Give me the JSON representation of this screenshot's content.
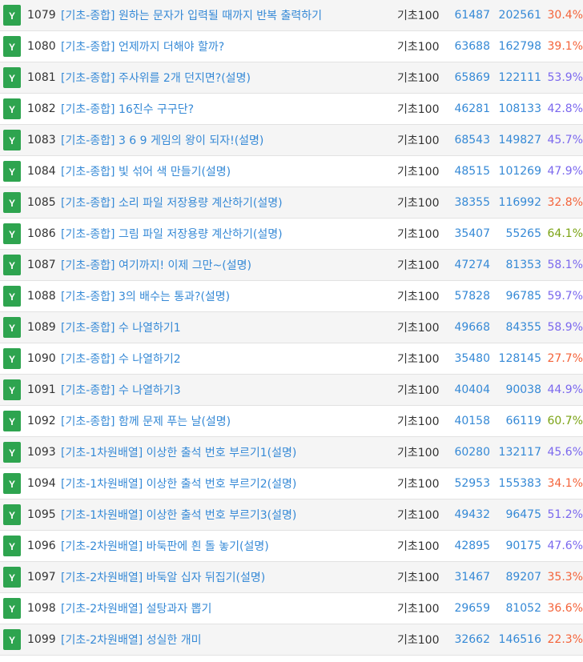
{
  "colors": {
    "badge": "#2ea44f",
    "link": "#3589d6",
    "rate_high": "#7ba314",
    "rate_mid": "#7b68ee",
    "rate_low": "#f4633a"
  },
  "problems": [
    {
      "badge": "Y",
      "id": "1079",
      "title": "[기초-종합] 원하는 문자가 입력될 때까지 반복 출력하기",
      "level": "기초100",
      "solved": "61487",
      "submissions": "202561",
      "rate": "30.4%",
      "rate_color": "#f4633a"
    },
    {
      "badge": "Y",
      "id": "1080",
      "title": "[기초-종합] 언제까지 더해야 할까?",
      "level": "기초100",
      "solved": "63688",
      "submissions": "162798",
      "rate": "39.1%",
      "rate_color": "#f4633a"
    },
    {
      "badge": "Y",
      "id": "1081",
      "title": "[기초-종합] 주사위를 2개 던지면?(설명)",
      "level": "기초100",
      "solved": "65869",
      "submissions": "122111",
      "rate": "53.9%",
      "rate_color": "#7b68ee"
    },
    {
      "badge": "Y",
      "id": "1082",
      "title": "[기초-종합] 16진수 구구단?",
      "level": "기초100",
      "solved": "46281",
      "submissions": "108133",
      "rate": "42.8%",
      "rate_color": "#7b68ee"
    },
    {
      "badge": "Y",
      "id": "1083",
      "title": "[기초-종합] 3 6 9 게임의 왕이 되자!(설명)",
      "level": "기초100",
      "solved": "68543",
      "submissions": "149827",
      "rate": "45.7%",
      "rate_color": "#7b68ee"
    },
    {
      "badge": "Y",
      "id": "1084",
      "title": "[기초-종합] 빛 섞어 색 만들기(설명)",
      "level": "기초100",
      "solved": "48515",
      "submissions": "101269",
      "rate": "47.9%",
      "rate_color": "#7b68ee"
    },
    {
      "badge": "Y",
      "id": "1085",
      "title": "[기초-종합] 소리 파일 저장용량 계산하기(설명)",
      "level": "기초100",
      "solved": "38355",
      "submissions": "116992",
      "rate": "32.8%",
      "rate_color": "#f4633a"
    },
    {
      "badge": "Y",
      "id": "1086",
      "title": "[기초-종합] 그림 파일 저장용량 계산하기(설명)",
      "level": "기초100",
      "solved": "35407",
      "submissions": "55265",
      "rate": "64.1%",
      "rate_color": "#7ba314"
    },
    {
      "badge": "Y",
      "id": "1087",
      "title": "[기초-종합] 여기까지! 이제 그만~(설명)",
      "level": "기초100",
      "solved": "47274",
      "submissions": "81353",
      "rate": "58.1%",
      "rate_color": "#7b68ee"
    },
    {
      "badge": "Y",
      "id": "1088",
      "title": "[기초-종합] 3의 배수는 통과?(설명)",
      "level": "기초100",
      "solved": "57828",
      "submissions": "96785",
      "rate": "59.7%",
      "rate_color": "#7b68ee"
    },
    {
      "badge": "Y",
      "id": "1089",
      "title": "[기초-종합] 수 나열하기1",
      "level": "기초100",
      "solved": "49668",
      "submissions": "84355",
      "rate": "58.9%",
      "rate_color": "#7b68ee"
    },
    {
      "badge": "Y",
      "id": "1090",
      "title": "[기초-종합] 수 나열하기2",
      "level": "기초100",
      "solved": "35480",
      "submissions": "128145",
      "rate": "27.7%",
      "rate_color": "#f4633a"
    },
    {
      "badge": "Y",
      "id": "1091",
      "title": "[기초-종합] 수 나열하기3",
      "level": "기초100",
      "solved": "40404",
      "submissions": "90038",
      "rate": "44.9%",
      "rate_color": "#7b68ee"
    },
    {
      "badge": "Y",
      "id": "1092",
      "title": "[기초-종합] 함께 문제 푸는 날(설명)",
      "level": "기초100",
      "solved": "40158",
      "submissions": "66119",
      "rate": "60.7%",
      "rate_color": "#7ba314"
    },
    {
      "badge": "Y",
      "id": "1093",
      "title": "[기초-1차원배열] 이상한 출석 번호 부르기1(설명)",
      "level": "기초100",
      "solved": "60280",
      "submissions": "132117",
      "rate": "45.6%",
      "rate_color": "#7b68ee"
    },
    {
      "badge": "Y",
      "id": "1094",
      "title": "[기초-1차원배열] 이상한 출석 번호 부르기2(설명)",
      "level": "기초100",
      "solved": "52953",
      "submissions": "155383",
      "rate": "34.1%",
      "rate_color": "#f4633a"
    },
    {
      "badge": "Y",
      "id": "1095",
      "title": "[기초-1차원배열] 이상한 출석 번호 부르기3(설명)",
      "level": "기초100",
      "solved": "49432",
      "submissions": "96475",
      "rate": "51.2%",
      "rate_color": "#7b68ee"
    },
    {
      "badge": "Y",
      "id": "1096",
      "title": "[기초-2차원배열] 바둑판에 흰 돌 놓기(설명)",
      "level": "기초100",
      "solved": "42895",
      "submissions": "90175",
      "rate": "47.6%",
      "rate_color": "#7b68ee"
    },
    {
      "badge": "Y",
      "id": "1097",
      "title": "[기초-2차원배열] 바둑알 십자 뒤집기(설명)",
      "level": "기초100",
      "solved": "31467",
      "submissions": "89207",
      "rate": "35.3%",
      "rate_color": "#f4633a"
    },
    {
      "badge": "Y",
      "id": "1098",
      "title": "[기초-2차원배열] 설탕과자 뽑기",
      "level": "기초100",
      "solved": "29659",
      "submissions": "81052",
      "rate": "36.6%",
      "rate_color": "#f4633a"
    },
    {
      "badge": "Y",
      "id": "1099",
      "title": "[기초-2차원배열] 성실한 개미",
      "level": "기초100",
      "solved": "32662",
      "submissions": "146516",
      "rate": "22.3%",
      "rate_color": "#f4633a"
    }
  ]
}
